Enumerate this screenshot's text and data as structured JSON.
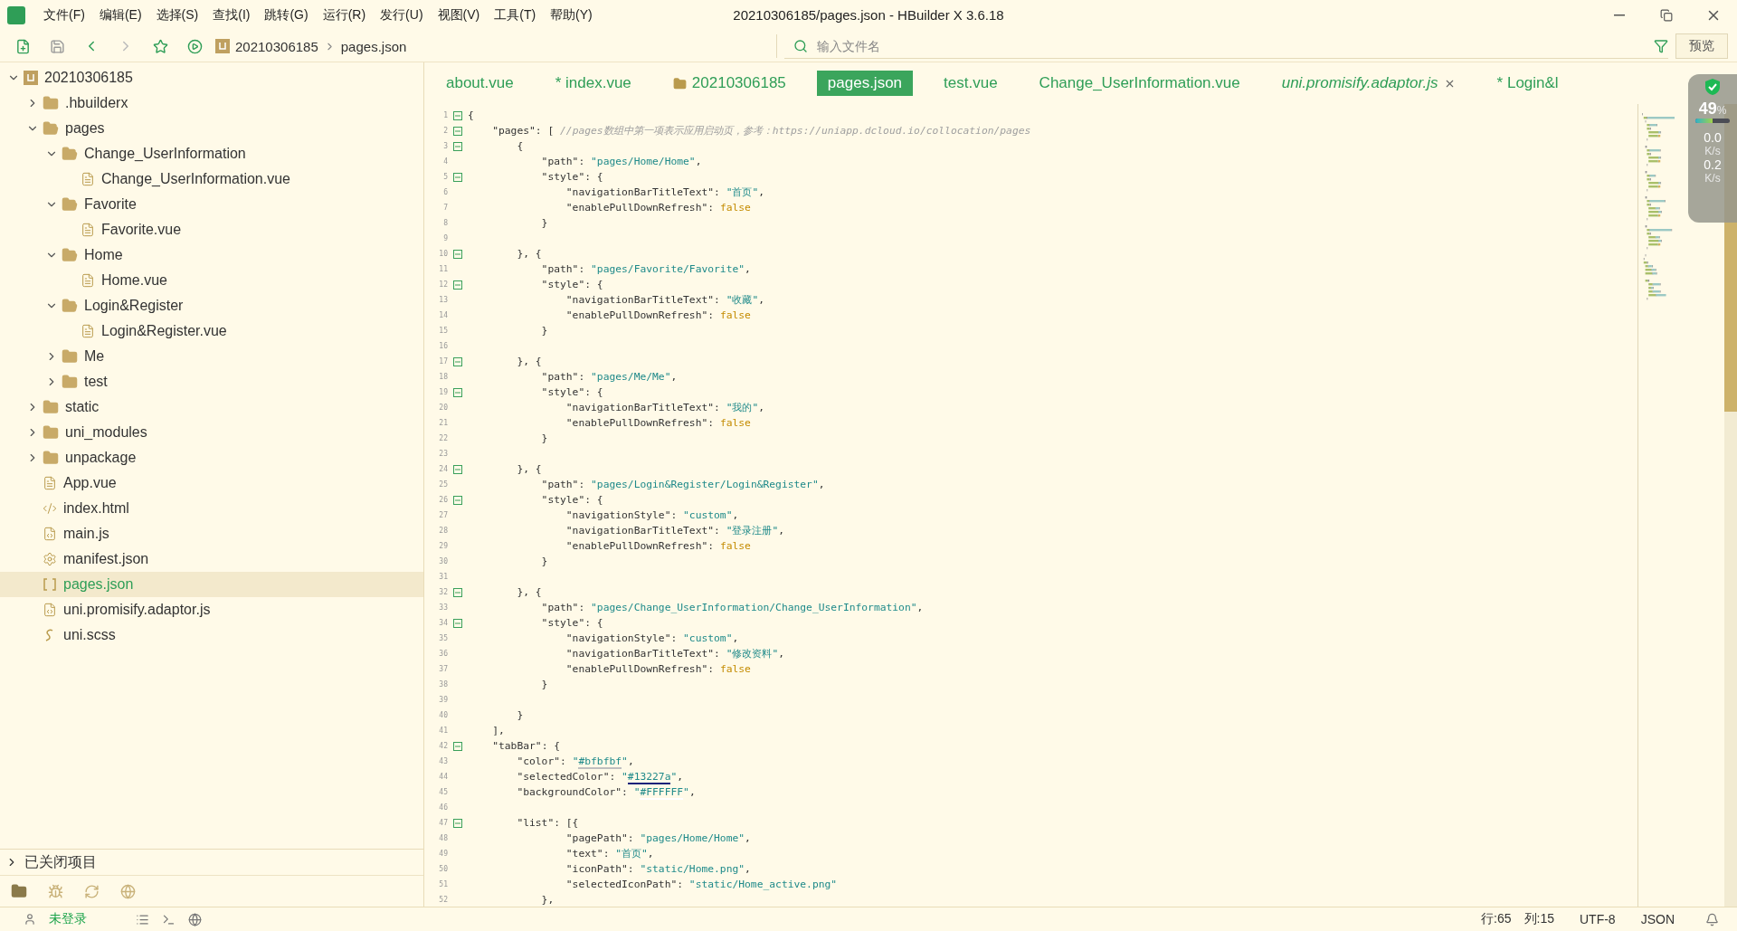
{
  "window": {
    "title": "20210306185/pages.json - HBuilder X 3.6.18"
  },
  "menu": [
    "文件(F)",
    "编辑(E)",
    "选择(S)",
    "查找(I)",
    "跳转(G)",
    "运行(R)",
    "发行(U)",
    "视图(V)",
    "工具(T)",
    "帮助(Y)"
  ],
  "toolbar": {
    "breadcrumb": [
      "20210306185",
      "pages.json"
    ],
    "search": {
      "placeholder": "输入文件名"
    },
    "preview_button": "预览"
  },
  "tabs": [
    {
      "label": "about.vue",
      "kind": "file",
      "selected": false,
      "preview": false,
      "closable": false
    },
    {
      "label": "* index.vue",
      "kind": "file",
      "selected": false,
      "preview": false,
      "closable": false
    },
    {
      "label": "20210306185",
      "kind": "folder",
      "selected": false,
      "preview": false,
      "closable": false
    },
    {
      "label": "pages.json",
      "kind": "file",
      "selected": true,
      "preview": false,
      "closable": false
    },
    {
      "label": "test.vue",
      "kind": "file",
      "selected": false,
      "preview": false,
      "closable": false
    },
    {
      "label": "Change_UserInformation.vue",
      "kind": "file",
      "selected": false,
      "preview": false,
      "closable": false
    },
    {
      "label": "uni.promisify.adaptor.js",
      "kind": "file",
      "selected": false,
      "preview": true,
      "closable": true
    },
    {
      "label": "* Login&l",
      "kind": "file",
      "selected": false,
      "preview": false,
      "closable": false
    }
  ],
  "sidebar": {
    "tree": [
      {
        "label": "20210306185",
        "kind": "project",
        "expanded": true,
        "selected": false,
        "children": [
          {
            "label": ".hbuilderx",
            "kind": "folder",
            "expanded": false,
            "selected": false
          },
          {
            "label": "pages",
            "kind": "folder",
            "expanded": true,
            "selected": false,
            "children": [
              {
                "label": "Change_UserInformation",
                "kind": "folder",
                "expanded": true,
                "selected": false,
                "children": [
                  {
                    "label": "Change_UserInformation.vue",
                    "kind": "vue",
                    "selected": false
                  }
                ]
              },
              {
                "label": "Favorite",
                "kind": "folder",
                "expanded": true,
                "selected": false,
                "children": [
                  {
                    "label": "Favorite.vue",
                    "kind": "vue",
                    "selected": false
                  }
                ]
              },
              {
                "label": "Home",
                "kind": "folder",
                "expanded": true,
                "selected": false,
                "children": [
                  {
                    "label": "Home.vue",
                    "kind": "vue",
                    "selected": false
                  }
                ]
              },
              {
                "label": "Login&Register",
                "kind": "folder",
                "expanded": true,
                "selected": false,
                "children": [
                  {
                    "label": "Login&Register.vue",
                    "kind": "vue",
                    "selected": false
                  }
                ]
              },
              {
                "label": "Me",
                "kind": "folder",
                "expanded": false,
                "selected": false
              },
              {
                "label": "test",
                "kind": "folder",
                "expanded": false,
                "selected": false
              }
            ]
          },
          {
            "label": "static",
            "kind": "folder",
            "expanded": false,
            "selected": false
          },
          {
            "label": "uni_modules",
            "kind": "folder",
            "expanded": false,
            "selected": false
          },
          {
            "label": "unpackage",
            "kind": "folder",
            "expanded": false,
            "selected": false
          },
          {
            "label": "App.vue",
            "kind": "vue",
            "selected": false
          },
          {
            "label": "index.html",
            "kind": "html",
            "selected": false
          },
          {
            "label": "main.js",
            "kind": "js",
            "selected": false
          },
          {
            "label": "manifest.json",
            "kind": "config",
            "selected": false
          },
          {
            "label": "pages.json",
            "kind": "json",
            "selected": true
          },
          {
            "label": "uni.promisify.adaptor.js",
            "kind": "js",
            "selected": false
          },
          {
            "label": "uni.scss",
            "kind": "scss",
            "selected": false
          }
        ]
      }
    ],
    "closed_projects": {
      "label": "已关闭项目",
      "expanded": false
    }
  },
  "editor": {
    "lines": [
      {
        "number": "1",
        "fold": true,
        "tokens": [
          {
            "kind": "plain",
            "text": "{"
          }
        ]
      },
      {
        "number": "2",
        "fold": true,
        "tokens": [
          {
            "kind": "key",
            "text": "    \"pages\""
          },
          {
            "kind": "plain",
            "text": ": [ "
          },
          {
            "kind": "comment",
            "text": "//pages数组中第一项表示应用启动页，参考：https://uniapp.dcloud.io/collocation/pages"
          }
        ]
      },
      {
        "number": "3",
        "fold": true,
        "tokens": [
          {
            "kind": "plain",
            "text": "        {"
          }
        ]
      },
      {
        "number": "4",
        "fold": false,
        "tokens": [
          {
            "kind": "key",
            "text": "            \"path\""
          },
          {
            "kind": "plain",
            "text": ": "
          },
          {
            "kind": "string",
            "text": "\"pages/Home/Home\""
          },
          {
            "kind": "plain",
            "text": ","
          }
        ]
      },
      {
        "number": "5",
        "fold": true,
        "tokens": [
          {
            "kind": "key",
            "text": "            \"style\""
          },
          {
            "kind": "plain",
            "text": ": {"
          }
        ]
      },
      {
        "number": "6",
        "fold": false,
        "tokens": [
          {
            "kind": "key",
            "text": "                \"navigationBarTitleText\""
          },
          {
            "kind": "plain",
            "text": ": "
          },
          {
            "kind": "string",
            "text": "\"首页\""
          },
          {
            "kind": "plain",
            "text": ","
          }
        ]
      },
      {
        "number": "7",
        "fold": false,
        "tokens": [
          {
            "kind": "key",
            "text": "                \"enablePullDownRefresh\""
          },
          {
            "kind": "plain",
            "text": ": "
          },
          {
            "kind": "bool",
            "text": "false"
          }
        ]
      },
      {
        "number": "8",
        "fold": false,
        "tokens": [
          {
            "kind": "plain",
            "text": "            }"
          }
        ]
      },
      {
        "number": "9",
        "fold": false
      },
      {
        "number": "10",
        "fold": true,
        "tokens": [
          {
            "kind": "plain",
            "text": "        }, {"
          }
        ]
      },
      {
        "number": "11",
        "fold": false,
        "tokens": [
          {
            "kind": "key",
            "text": "            \"path\""
          },
          {
            "kind": "plain",
            "text": ": "
          },
          {
            "kind": "string",
            "text": "\"pages/Favorite/Favorite\""
          },
          {
            "kind": "plain",
            "text": ","
          }
        ]
      },
      {
        "number": "12",
        "fold": true,
        "tokens": [
          {
            "kind": "key",
            "text": "            \"style\""
          },
          {
            "kind": "plain",
            "text": ": {"
          }
        ]
      },
      {
        "number": "13",
        "fold": false,
        "tokens": [
          {
            "kind": "key",
            "text": "                \"navigationBarTitleText\""
          },
          {
            "kind": "plain",
            "text": ": "
          },
          {
            "kind": "string",
            "text": "\"收藏\""
          },
          {
            "kind": "plain",
            "text": ","
          }
        ]
      },
      {
        "number": "14",
        "fold": false,
        "tokens": [
          {
            "kind": "key",
            "text": "                \"enablePullDownRefresh\""
          },
          {
            "kind": "plain",
            "text": ": "
          },
          {
            "kind": "bool",
            "text": "false"
          }
        ]
      },
      {
        "number": "15",
        "fold": false,
        "tokens": [
          {
            "kind": "plain",
            "text": "            }"
          }
        ]
      },
      {
        "number": "16",
        "fold": false
      },
      {
        "number": "17",
        "fold": true,
        "tokens": [
          {
            "kind": "plain",
            "text": "        }, {"
          }
        ]
      },
      {
        "number": "18",
        "fold": false,
        "tokens": [
          {
            "kind": "key",
            "text": "            \"path\""
          },
          {
            "kind": "plain",
            "text": ": "
          },
          {
            "kind": "string",
            "text": "\"pages/Me/Me\""
          },
          {
            "kind": "plain",
            "text": ","
          }
        ]
      },
      {
        "number": "19",
        "fold": true,
        "tokens": [
          {
            "kind": "key",
            "text": "            \"style\""
          },
          {
            "kind": "plain",
            "text": ": {"
          }
        ]
      },
      {
        "number": "20",
        "fold": false,
        "tokens": [
          {
            "kind": "key",
            "text": "                \"navigationBarTitleText\""
          },
          {
            "kind": "plain",
            "text": ": "
          },
          {
            "kind": "string",
            "text": "\"我的\""
          },
          {
            "kind": "plain",
            "text": ","
          }
        ]
      },
      {
        "number": "21",
        "fold": false,
        "tokens": [
          {
            "kind": "key",
            "text": "                \"enablePullDownRefresh\""
          },
          {
            "kind": "plain",
            "text": ": "
          },
          {
            "kind": "bool",
            "text": "false"
          }
        ]
      },
      {
        "number": "22",
        "fold": false,
        "tokens": [
          {
            "kind": "plain",
            "text": "            }"
          }
        ]
      },
      {
        "number": "23",
        "fold": false
      },
      {
        "number": "24",
        "fold": true,
        "tokens": [
          {
            "kind": "plain",
            "text": "        }, {"
          }
        ]
      },
      {
        "number": "25",
        "fold": false,
        "tokens": [
          {
            "kind": "key",
            "text": "            \"path\""
          },
          {
            "kind": "plain",
            "text": ": "
          },
          {
            "kind": "string",
            "text": "\"pages/Login&Register/Login&Register\""
          },
          {
            "kind": "plain",
            "text": ","
          }
        ]
      },
      {
        "number": "26",
        "fold": true,
        "tokens": [
          {
            "kind": "key",
            "text": "            \"style\""
          },
          {
            "kind": "plain",
            "text": ": {"
          }
        ]
      },
      {
        "number": "27",
        "fold": false,
        "tokens": [
          {
            "kind": "key",
            "text": "                \"navigationStyle\""
          },
          {
            "kind": "plain",
            "text": ": "
          },
          {
            "kind": "string",
            "text": "\"custom\""
          },
          {
            "kind": "plain",
            "text": ","
          }
        ]
      },
      {
        "number": "28",
        "fold": false,
        "tokens": [
          {
            "kind": "key",
            "text": "                \"navigationBarTitleText\""
          },
          {
            "kind": "plain",
            "text": ": "
          },
          {
            "kind": "string",
            "text": "\"登录注册\""
          },
          {
            "kind": "plain",
            "text": ","
          }
        ]
      },
      {
        "number": "29",
        "fold": false,
        "tokens": [
          {
            "kind": "key",
            "text": "                \"enablePullDownRefresh\""
          },
          {
            "kind": "plain",
            "text": ": "
          },
          {
            "kind": "bool",
            "text": "false"
          }
        ]
      },
      {
        "number": "30",
        "fold": false,
        "tokens": [
          {
            "kind": "plain",
            "text": "            }"
          }
        ]
      },
      {
        "number": "31",
        "fold": false
      },
      {
        "number": "32",
        "fold": true,
        "tokens": [
          {
            "kind": "plain",
            "text": "        }, {"
          }
        ]
      },
      {
        "number": "33",
        "fold": false,
        "tokens": [
          {
            "kind": "key",
            "text": "            \"path\""
          },
          {
            "kind": "plain",
            "text": ": "
          },
          {
            "kind": "string",
            "text": "\"pages/Change_UserInformation/Change_UserInformation\""
          },
          {
            "kind": "plain",
            "text": ","
          }
        ]
      },
      {
        "number": "34",
        "fold": true,
        "tokens": [
          {
            "kind": "key",
            "text": "            \"style\""
          },
          {
            "kind": "plain",
            "text": ": {"
          }
        ]
      },
      {
        "number": "35",
        "fold": false,
        "tokens": [
          {
            "kind": "key",
            "text": "                \"navigationStyle\""
          },
          {
            "kind": "plain",
            "text": ": "
          },
          {
            "kind": "string",
            "text": "\"custom\""
          },
          {
            "kind": "plain",
            "text": ","
          }
        ]
      },
      {
        "number": "36",
        "fold": false,
        "tokens": [
          {
            "kind": "key",
            "text": "                \"navigationBarTitleText\""
          },
          {
            "kind": "plain",
            "text": ": "
          },
          {
            "kind": "string",
            "text": "\"修改资料\""
          },
          {
            "kind": "plain",
            "text": ","
          }
        ]
      },
      {
        "number": "37",
        "fold": false,
        "tokens": [
          {
            "kind": "key",
            "text": "                \"enablePullDownRefresh\""
          },
          {
            "kind": "plain",
            "text": ": "
          },
          {
            "kind": "bool",
            "text": "false"
          }
        ]
      },
      {
        "number": "38",
        "fold": false,
        "tokens": [
          {
            "kind": "plain",
            "text": "            }"
          }
        ]
      },
      {
        "number": "39",
        "fold": false
      },
      {
        "number": "40",
        "fold": false,
        "tokens": [
          {
            "kind": "plain",
            "text": "        }"
          }
        ]
      },
      {
        "number": "41",
        "fold": false,
        "tokens": [
          {
            "kind": "plain",
            "text": "    ],"
          }
        ]
      },
      {
        "number": "42",
        "fold": true,
        "tokens": [
          {
            "kind": "key",
            "text": "    \"tabBar\""
          },
          {
            "kind": "plain",
            "text": ": {"
          }
        ]
      },
      {
        "number": "43",
        "fold": false,
        "tokens": [
          {
            "kind": "key",
            "text": "        \"color\""
          },
          {
            "kind": "plain",
            "text": ": "
          },
          {
            "kind": "string",
            "text": "\""
          },
          {
            "kind": "color",
            "text": "#bfbfbf",
            "color": "#bfbfbf"
          },
          {
            "kind": "string",
            "text": "\""
          },
          {
            "kind": "plain",
            "text": ","
          }
        ]
      },
      {
        "number": "44",
        "fold": false,
        "tokens": [
          {
            "kind": "key",
            "text": "        \"selectedColor\""
          },
          {
            "kind": "plain",
            "text": ": "
          },
          {
            "kind": "string",
            "text": "\""
          },
          {
            "kind": "color",
            "text": "#13227a",
            "color": "#13227a"
          },
          {
            "kind": "string",
            "text": "\""
          },
          {
            "kind": "plain",
            "text": ","
          }
        ]
      },
      {
        "number": "45",
        "fold": false,
        "tokens": [
          {
            "kind": "key",
            "text": "        \"backgroundColor\""
          },
          {
            "kind": "plain",
            "text": ": "
          },
          {
            "kind": "string",
            "text": "\""
          },
          {
            "kind": "color",
            "text": "#FFFFFF",
            "color": "#ffffff"
          },
          {
            "kind": "string",
            "text": "\""
          },
          {
            "kind": "plain",
            "text": ","
          }
        ]
      },
      {
        "number": "46",
        "fold": false
      },
      {
        "number": "47",
        "fold": true,
        "tokens": [
          {
            "kind": "key",
            "text": "        \"list\""
          },
          {
            "kind": "plain",
            "text": ": [{"
          }
        ]
      },
      {
        "number": "48",
        "fold": false,
        "tokens": [
          {
            "kind": "key",
            "text": "                \"pagePath\""
          },
          {
            "kind": "plain",
            "text": ": "
          },
          {
            "kind": "string",
            "text": "\"pages/Home/Home\""
          },
          {
            "kind": "plain",
            "text": ","
          }
        ]
      },
      {
        "number": "49",
        "fold": false,
        "tokens": [
          {
            "kind": "key",
            "text": "                \"text\""
          },
          {
            "kind": "plain",
            "text": ": "
          },
          {
            "kind": "string",
            "text": "\"首页\""
          },
          {
            "kind": "plain",
            "text": ","
          }
        ]
      },
      {
        "number": "50",
        "fold": false,
        "tokens": [
          {
            "kind": "key",
            "text": "                \"iconPath\""
          },
          {
            "kind": "plain",
            "text": ": "
          },
          {
            "kind": "string",
            "text": "\"static/Home.png\""
          },
          {
            "kind": "plain",
            "text": ","
          }
        ]
      },
      {
        "number": "51",
        "fold": false,
        "tokens": [
          {
            "kind": "key",
            "text": "                \"selectedIconPath\""
          },
          {
            "kind": "plain",
            "text": ": "
          },
          {
            "kind": "string",
            "text": "\"static/Home_active.png\""
          }
        ]
      },
      {
        "number": "52",
        "fold": false,
        "tokens": [
          {
            "kind": "plain",
            "text": "            },"
          }
        ]
      }
    ]
  },
  "monitor": {
    "percent": "49",
    "unit": "%",
    "level": 0.49,
    "upload": "0.0",
    "upload_unit": "K/s",
    "download": "0.2",
    "download_unit": "K/s"
  },
  "status_bar": {
    "user": "未登录",
    "line": "行:65",
    "column": "列:15",
    "encoding": "UTF-8",
    "language": "JSON"
  }
}
